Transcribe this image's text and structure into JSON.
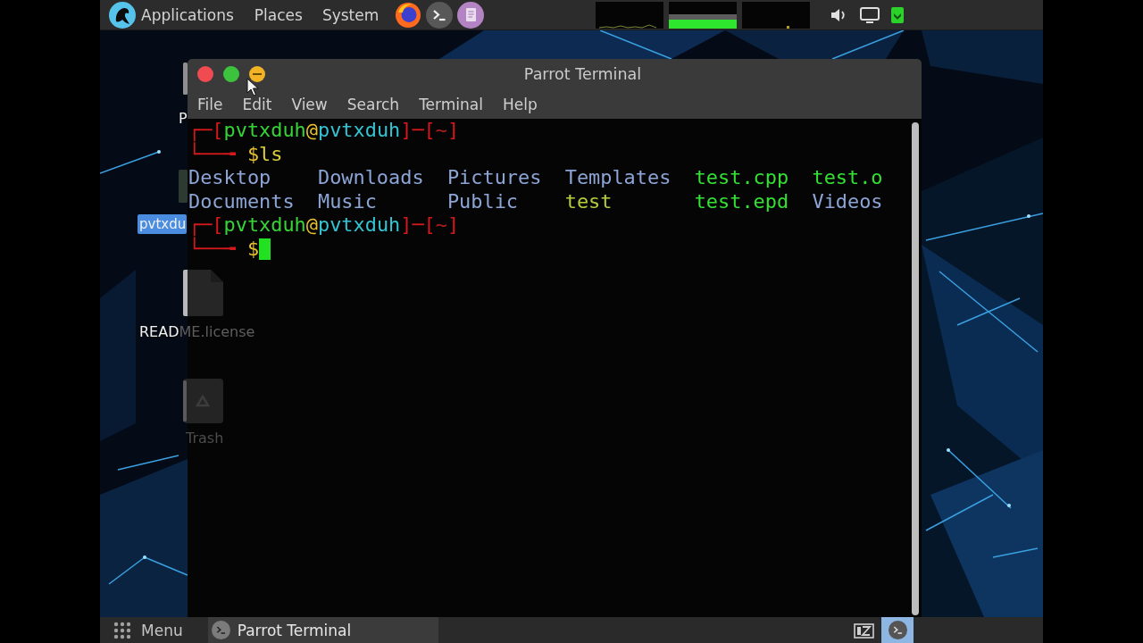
{
  "top_panel": {
    "menus": [
      "Applications",
      "Places",
      "System"
    ]
  },
  "desktop_icons": [
    {
      "label": "P",
      "selected": false
    },
    {
      "label": "pvtxdu",
      "selected": true
    },
    {
      "label": "README.license",
      "selected": false
    },
    {
      "label": "Trash",
      "selected": false
    }
  ],
  "window": {
    "title": "Parrot Terminal",
    "menu": [
      "File",
      "Edit",
      "View",
      "Search",
      "Terminal",
      "Help"
    ]
  },
  "terminal": {
    "lines": [
      {
        "kind": "prompt",
        "cursor": false,
        "segments": [
          {
            "text": "┌─[",
            "kind": "frame"
          },
          {
            "text": "pvtxduh",
            "kind": "user"
          },
          {
            "text": "@",
            "kind": "at"
          },
          {
            "text": "pvtxduh",
            "kind": "host"
          },
          {
            "text": "]─[",
            "kind": "frame"
          },
          {
            "text": "~",
            "kind": "path"
          },
          {
            "text": "]",
            "kind": "frame"
          }
        ]
      },
      {
        "kind": "prompt",
        "cursor": false,
        "segments": [
          {
            "text": "└──╼ ",
            "kind": "frame"
          },
          {
            "text": "$",
            "kind": "sign"
          },
          {
            "text": "ls",
            "kind": "command"
          }
        ]
      },
      {
        "kind": "listing",
        "rows": [
          [
            {
              "name": "Desktop",
              "color": "#8ca5d6"
            },
            {
              "name": "Downloads",
              "color": "#8ca5d6"
            },
            {
              "name": "Pictures",
              "color": "#8ca5d6"
            },
            {
              "name": "Templates",
              "color": "#8ca5d6"
            },
            {
              "name": "test.cpp",
              "color": "#34e034"
            },
            {
              "name": "test.o",
              "color": "#34e034"
            }
          ],
          [
            {
              "name": "Documents",
              "color": "#8ca5d6"
            },
            {
              "name": "Music",
              "color": "#8ca5d6"
            },
            {
              "name": "Public",
              "color": "#8ca5d6"
            },
            {
              "name": "test",
              "color": "#b7cc3c"
            },
            {
              "name": "test.epd",
              "color": "#34e034"
            },
            {
              "name": "Videos",
              "color": "#8ca5d6"
            }
          ]
        ]
      },
      {
        "kind": "prompt",
        "cursor": false,
        "segments": [
          {
            "text": "┌─[",
            "kind": "frame"
          },
          {
            "text": "pvtxduh",
            "kind": "user"
          },
          {
            "text": "@",
            "kind": "at"
          },
          {
            "text": "pvtxduh",
            "kind": "host"
          },
          {
            "text": "]─[",
            "kind": "frame"
          },
          {
            "text": "~",
            "kind": "path"
          },
          {
            "text": "]",
            "kind": "frame"
          }
        ]
      },
      {
        "kind": "prompt",
        "cursor": true,
        "segments": [
          {
            "text": "└──╼ ",
            "kind": "frame"
          },
          {
            "text": "$",
            "kind": "sign"
          }
        ]
      }
    ]
  },
  "bottom_panel": {
    "menu_label": "Menu",
    "tasks": [
      {
        "label": "Parrot Terminal",
        "selected": true
      }
    ],
    "tray": [
      {
        "selected": false
      },
      {
        "selected": true
      }
    ]
  }
}
